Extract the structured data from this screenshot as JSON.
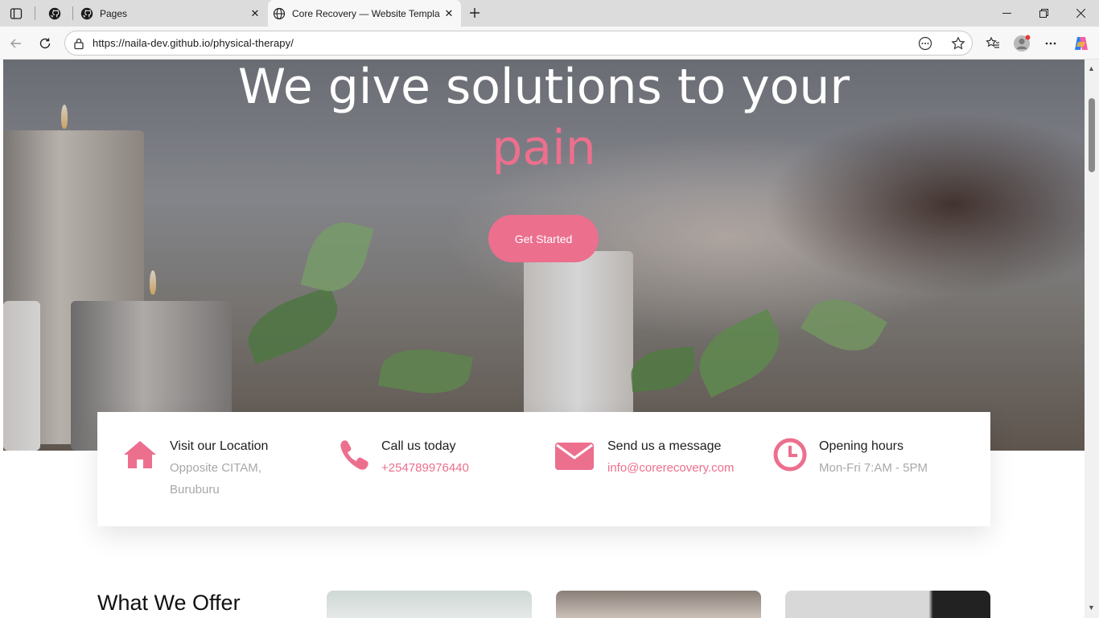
{
  "browser": {
    "tabs": [
      {
        "title": "Pages"
      },
      {
        "title": "Core Recovery — Website Templa"
      }
    ],
    "url": "https://naila-dev.github.io/physical-therapy/"
  },
  "page": {
    "hero": {
      "headline": "We give solutions to your",
      "accent_word": "pain",
      "cta_label": "Get Started"
    },
    "info": [
      {
        "title": "Visit our Location",
        "value_lines": [
          "Opposite CITAM,",
          "Buruburu"
        ],
        "icon": "home-icon"
      },
      {
        "title": "Call us today",
        "value_lines": [
          "+254789976440"
        ],
        "icon": "phone-icon"
      },
      {
        "title": "Send us a message",
        "value_lines": [
          "info@corerecovery.com"
        ],
        "icon": "envelope-icon"
      },
      {
        "title": "Opening hours",
        "value_lines": [
          "Mon-Fri 7:AM - 5PM"
        ],
        "icon": "clock-icon"
      }
    ],
    "offer_heading": "What We Offer"
  },
  "colors": {
    "accent": "#ec6f8e",
    "muted_text": "#a8a8a8"
  }
}
